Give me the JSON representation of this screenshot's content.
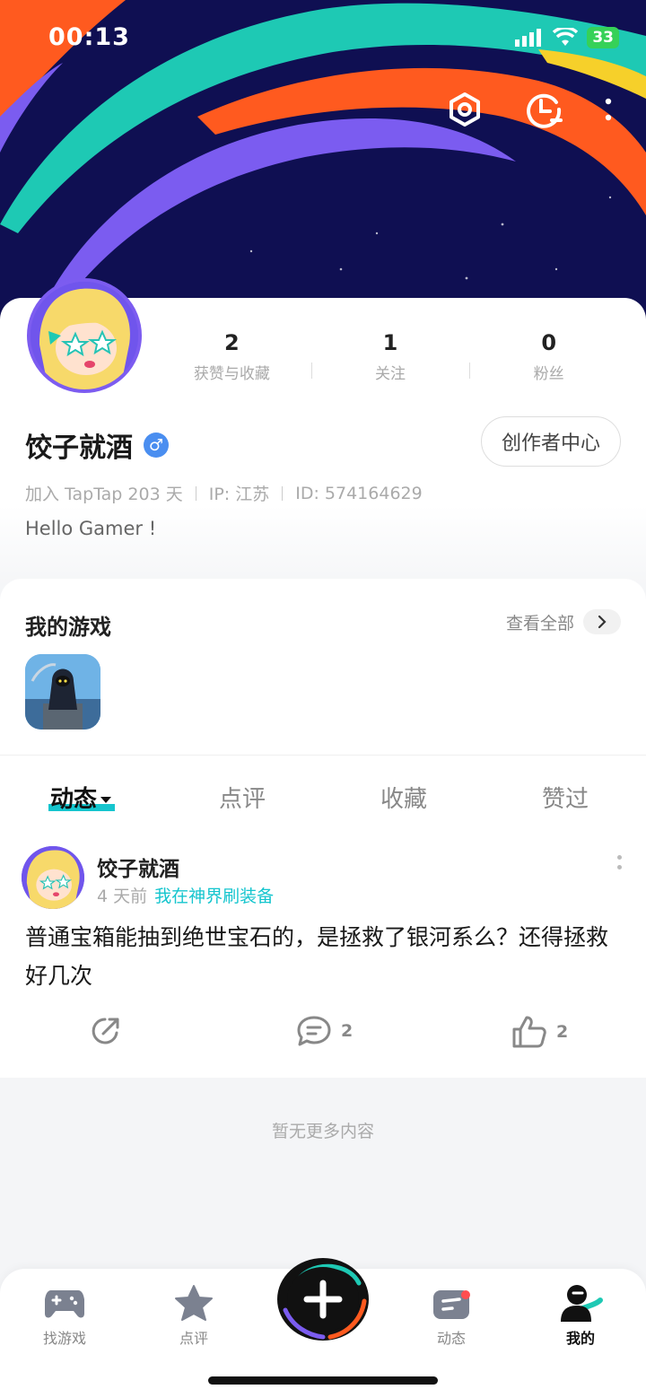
{
  "status_bar": {
    "time": "00:13",
    "battery": "33"
  },
  "header_icons": [
    "settings-hex-icon",
    "history-icon",
    "more-vertical-icon"
  ],
  "profile": {
    "stats": [
      {
        "value": "2",
        "label": "获赞与收藏"
      },
      {
        "value": "1",
        "label": "关注"
      },
      {
        "value": "0",
        "label": "粉丝"
      }
    ],
    "name": "饺子就酒",
    "gender_symbol": "♂",
    "creator_button": "创作者中心",
    "joined": "加入 TapTap 203 天",
    "ip": "IP: 江苏",
    "id": "ID: 574164629",
    "bio": "Hello Gamer !"
  },
  "games": {
    "title": "我的游戏",
    "view_all": "查看全部"
  },
  "tabs": [
    {
      "label": "动态",
      "active": true
    },
    {
      "label": "点评",
      "active": false
    },
    {
      "label": "收藏",
      "active": false
    },
    {
      "label": "赞过",
      "active": false
    }
  ],
  "post": {
    "author": "饺子就酒",
    "time": "4 天前",
    "tag": "我在神界刷装备",
    "text": "普通宝箱能抽到绝世宝石的，是拯救了银河系么？还得拯救好几次",
    "comments": "2",
    "likes": "2"
  },
  "no_more": "暂无更多内容",
  "bottom_nav": [
    {
      "label": "找游戏",
      "icon": "gamepad-icon"
    },
    {
      "label": "点评",
      "icon": "star-icon"
    },
    {
      "label": "",
      "icon": "plus-icon"
    },
    {
      "label": "动态",
      "icon": "feed-icon"
    },
    {
      "label": "我的",
      "icon": "profile-icon"
    }
  ],
  "colors": {
    "accent": "#15c5ce",
    "banner_bg": "#0f0f52",
    "orange": "#ff5a1f",
    "teal": "#1ec9b4",
    "purple": "#7b5cf0"
  }
}
